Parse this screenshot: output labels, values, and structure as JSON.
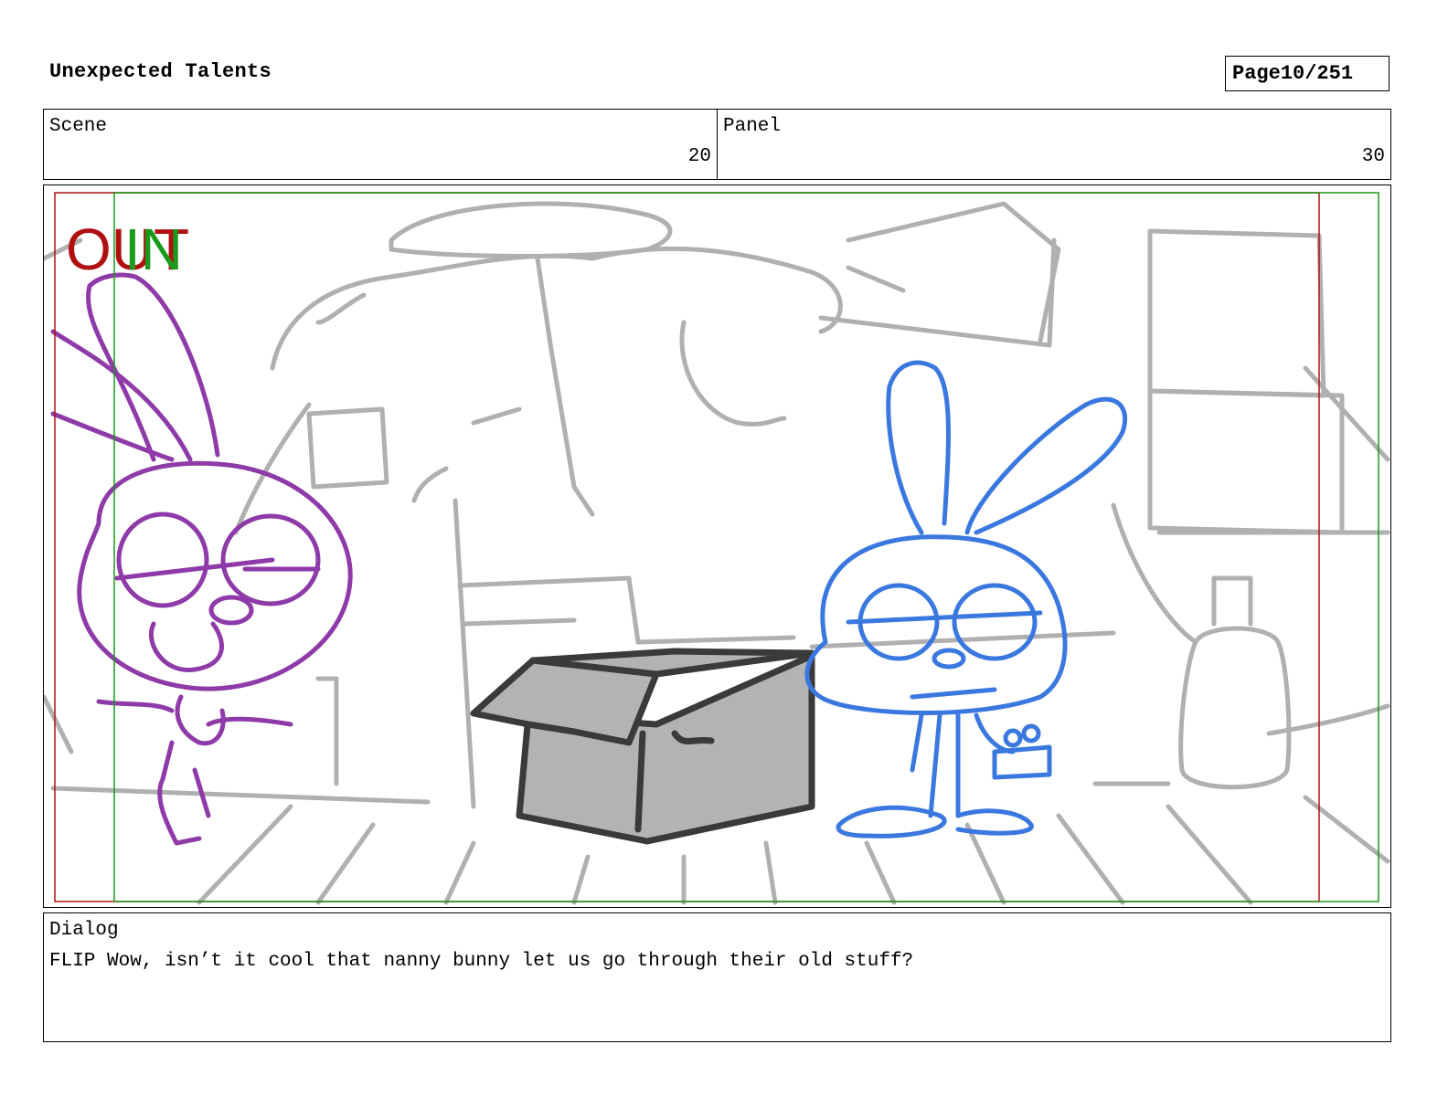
{
  "header": {
    "project_title": "Unexpected Talents",
    "page_label": "Page",
    "page_number": "10/251"
  },
  "scene": {
    "label": "Scene",
    "value": "20"
  },
  "panel": {
    "label": "Panel",
    "value": "30"
  },
  "drawing": {
    "out_label": "OUT",
    "in_label": "IN",
    "out_color": "#b01010",
    "in_color": "#1a9a1a",
    "background_color": "#b0b0b0",
    "character_left_color": "#8e3aa8",
    "character_right_color": "#3a78e0",
    "box_color": "#b3b3b3",
    "box_outline_color": "#3a3a3a"
  },
  "dialog": {
    "label": "Dialog",
    "text": "FLIP Wow, isn’t it cool that nanny bunny let us go through their old stuff?"
  }
}
